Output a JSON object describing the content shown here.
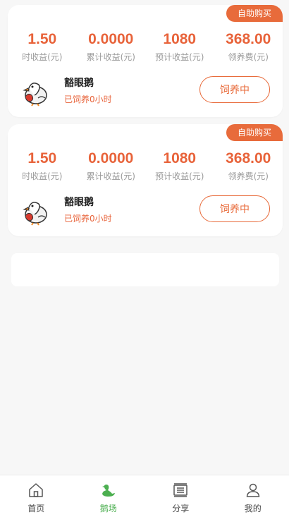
{
  "cards": [
    {
      "badge": "自助购买",
      "stats": [
        {
          "value": "1.50",
          "label": "时收益(元)"
        },
        {
          "value": "0.0000",
          "label": "累计收益(元)"
        },
        {
          "value": "1080",
          "label": "预计收益(元)"
        },
        {
          "value": "368.00",
          "label": "领养费(元)"
        }
      ],
      "name": "豁眼鹅",
      "status": "已饲养0小时",
      "button": "饲养中"
    },
    {
      "badge": "自助购买",
      "stats": [
        {
          "value": "1.50",
          "label": "时收益(元)"
        },
        {
          "value": "0.0000",
          "label": "累计收益(元)"
        },
        {
          "value": "1080",
          "label": "预计收益(元)"
        },
        {
          "value": "368.00",
          "label": "领养费(元)"
        }
      ],
      "name": "豁眼鹅",
      "status": "已饲养0小时",
      "button": "饲养中"
    }
  ],
  "tabbar": {
    "items": [
      {
        "label": "首页",
        "icon": "home-icon"
      },
      {
        "label": "鹅场",
        "icon": "goose-icon"
      },
      {
        "label": "分享",
        "icon": "share-icon"
      },
      {
        "label": "我的",
        "icon": "user-icon"
      }
    ],
    "active_index": 1
  },
  "colors": {
    "accent": "#e86b3b",
    "active_tab": "#4caf50",
    "background": "#f7f7f7"
  }
}
